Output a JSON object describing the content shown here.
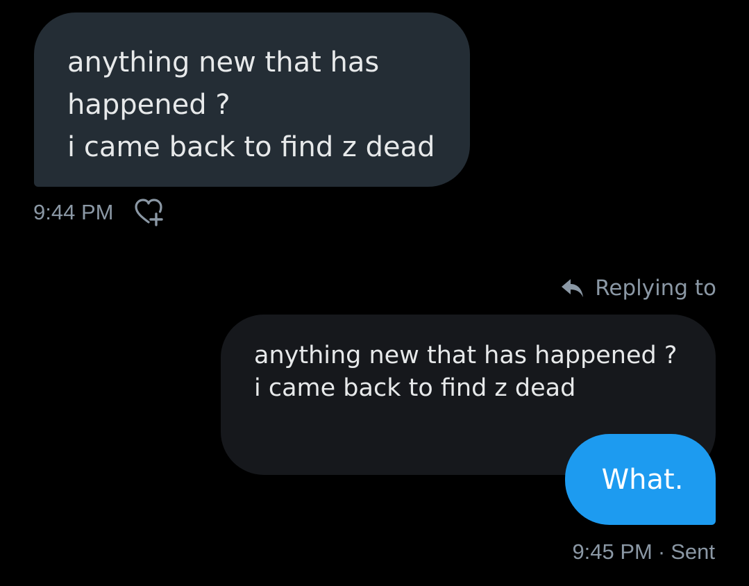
{
  "colors": {
    "background": "#000000",
    "incoming_bubble": "#242d35",
    "quoted_bubble": "#16181c",
    "outgoing_bubble": "#1d9bf0",
    "text_primary": "#e7e9ea",
    "text_muted": "#8b98a5"
  },
  "incoming_message": {
    "lines": [
      "anything new that has",
      "happened ?",
      "i came back to find z dead"
    ],
    "time": "9:44 PM",
    "react_icon": "heart-plus-icon"
  },
  "reply": {
    "label": "Replying to",
    "icon": "reply-arrow-icon",
    "quoted_lines": [
      "anything new that has happened ?",
      "i came back to find z dead"
    ]
  },
  "outgoing_message": {
    "text": "What.",
    "time": "9:45 PM",
    "separator": "·",
    "status": "Sent"
  }
}
